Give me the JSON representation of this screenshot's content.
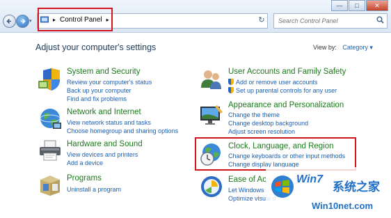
{
  "window": {
    "min": "—",
    "max": "□",
    "close": "✕"
  },
  "address": {
    "segment": "Control Panel",
    "arrow_left": "▸",
    "arrow_right": "▸"
  },
  "search": {
    "placeholder": "Search Control Panel"
  },
  "page": {
    "title": "Adjust your computer's settings",
    "view_by_label": "View by:",
    "view_by_value": "Category ▾"
  },
  "categories": [
    {
      "title": "System and Security",
      "links": [
        "Review your computer's status",
        "Back up your computer",
        "Find and fix problems"
      ]
    },
    {
      "title": "Network and Internet",
      "links": [
        "View network status and tasks",
        "Choose homegroup and sharing options"
      ]
    },
    {
      "title": "Hardware and Sound",
      "links": [
        "View devices and printers",
        "Add a device"
      ]
    },
    {
      "title": "Programs",
      "links": [
        "Uninstall a program"
      ]
    },
    {
      "title": "User Accounts and Family Safety",
      "links": [
        "Add or remove user accounts",
        "Set up parental controls for any user"
      ]
    },
    {
      "title": "Appearance and Personalization",
      "links": [
        "Change the theme",
        "Change desktop background",
        "Adjust screen resolution"
      ]
    },
    {
      "title": "Clock, Language, and Region",
      "links": [
        "Change keyboards or other input methods",
        "Change display language"
      ]
    },
    {
      "title": "Ease of Ac",
      "links": [
        "Let Windows",
        "Optimize visual d"
      ]
    }
  ],
  "watermark": {
    "brand": "Win7",
    "cn": "系统之家",
    "url": "Win10net.com"
  },
  "colors": {
    "highlight": "#d3141e",
    "heading": "#1a7a1a",
    "link": "#1b5fb3"
  }
}
